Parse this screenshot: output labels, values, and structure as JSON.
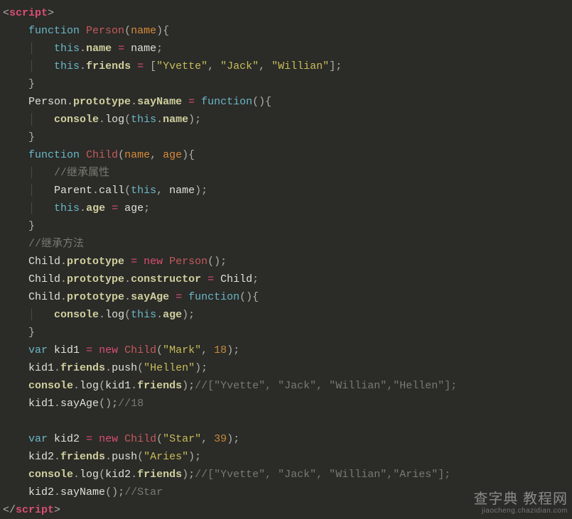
{
  "code": {
    "open_tag_lt": "<",
    "open_tag_name": "script",
    "open_tag_gt": ">",
    "close_tag_lt": "</",
    "close_tag_name": "script",
    "close_tag_gt": ">",
    "kw_function": "function",
    "kw_var": "var",
    "kw_new": "new",
    "kw_this": "this",
    "fn_Person": "Person",
    "fn_Child": "Child",
    "fn_Parent": "Parent",
    "fn_function": "function",
    "p_name": "name",
    "p_age": "age",
    "prop_name": "name",
    "prop_friends": "friends",
    "prop_prototype": "prototype",
    "prop_sayName": "sayName",
    "prop_sayAge": "sayAge",
    "prop_constructor": "constructor",
    "prop_age": "age",
    "prop_push": "push",
    "prop_log": "log",
    "id_console": "console",
    "id_kid1": "kid1",
    "id_kid2": "kid2",
    "id_Child": "Child",
    "id_name": "name",
    "id_age": "age",
    "id_call": "call",
    "str_Yvette": "\"Yvette\"",
    "str_Jack": "\"Jack\"",
    "str_Willian": "\"Willian\"",
    "str_Mark": "\"Mark\"",
    "str_Hellen": "\"Hellen\"",
    "str_Star": "\"Star\"",
    "str_Aries": "\"Aries\"",
    "num_18": "18",
    "num_39": "39",
    "cmt_inherit_prop": "//继承属性",
    "cmt_inherit_method": "//继承方法",
    "cmt_arr_hellen": "//[\"Yvette\", \"Jack\", \"Willian\",\"Hellen\"];",
    "cmt_18": "//18",
    "cmt_arr_aries": "//[\"Yvette\", \"Jack\", \"Willian\",\"Aries\"];",
    "cmt_star": "//Star",
    "eq": " = ",
    "dot": ".",
    "semi": ";",
    "comma": ", ",
    "lparen": "(",
    "rparen": ")",
    "lbrace": "{",
    "rbrace": "}",
    "lbrack": "[",
    "rbrack": "]",
    "empty_parens": "()",
    "guide": "│   "
  },
  "watermark": {
    "line1": "查字典 教程网",
    "line2": "jiaocheng.chazidian.com"
  }
}
